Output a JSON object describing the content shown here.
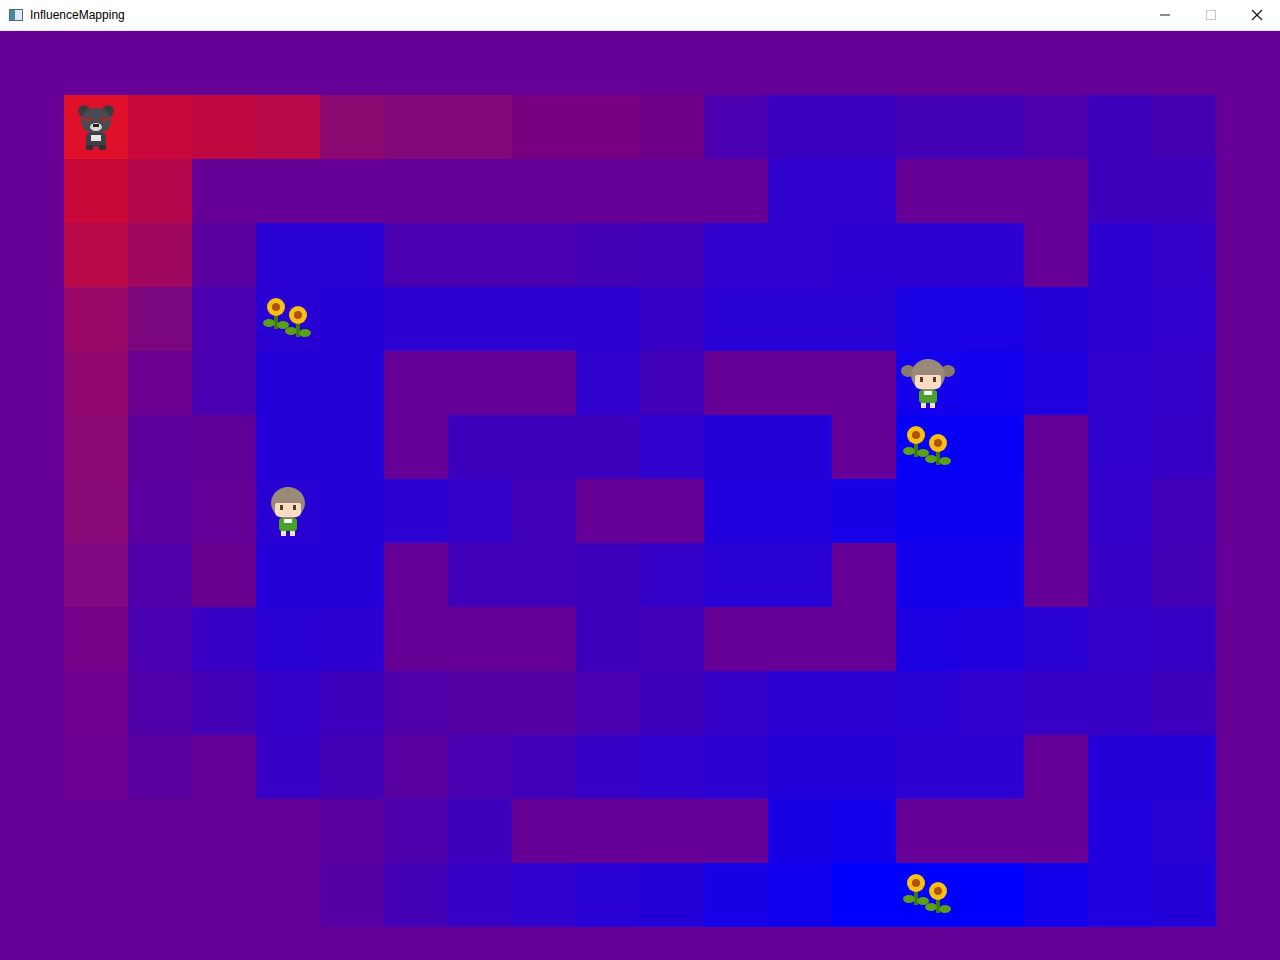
{
  "window": {
    "title": "InfluenceMapping",
    "controls": [
      {
        "kind": "minimize",
        "disabled": false
      },
      {
        "kind": "maximize",
        "disabled": true
      },
      {
        "kind": "close",
        "disabled": false
      }
    ]
  },
  "map": {
    "rows": [
      [
        "#660096",
        "#660096",
        "#660096",
        "#660096",
        "#660096",
        "#660096",
        "#660096",
        "#660096",
        "#660096",
        "#660096",
        "#660096",
        "#660096",
        "#660096",
        "#660096",
        "#660096",
        "#660096",
        "#660096",
        "#660096",
        "#660096",
        "#660096"
      ],
      [
        "#660096",
        "#e0102a",
        "#c8083a",
        "#c00840",
        "#b80848",
        "#8a0870",
        "#800878",
        "#800878",
        "#780080",
        "#780080",
        "#6e0088",
        "#4a00b0",
        "#3a00c0",
        "#3a00c0",
        "#4400b4",
        "#4400b4",
        "#4c00ac",
        "#3c00bc",
        "#4400b0",
        "#660096"
      ],
      [
        "#660096",
        "#c80838",
        "#b4084c",
        "#660096",
        "#660096",
        "#660096",
        "#660096",
        "#660096",
        "#660096",
        "#660096",
        "#660096",
        "#660096",
        "#3000cc",
        "#3000cc",
        "#660096",
        "#660096",
        "#660096",
        "#3c00bc",
        "#3c00bc",
        "#660096"
      ],
      [
        "#660096",
        "#b80848",
        "#a00860",
        "#5a00a0",
        "#2800d4",
        "#2800d4",
        "#4800b0",
        "#4800b0",
        "#4800b0",
        "#4400b4",
        "#4000b8",
        "#3000cc",
        "#3000cc",
        "#2c00d0",
        "#2c00d0",
        "#2c00d0",
        "#660096",
        "#2c00d0",
        "#3400c8",
        "#660096"
      ],
      [
        "#660096",
        "#9a0868",
        "#7c0880",
        "#4a00b0",
        "#2800d4",
        "#2400d8",
        "#2c00d0",
        "#2c00d0",
        "#2c00d0",
        "#2c00d0",
        "#3800c4",
        "#2800d4",
        "#2800d4",
        "#2800d4",
        "#1a00e4",
        "#1a00e4",
        "#2400d8",
        "#2c00d0",
        "#3000cc",
        "#660096"
      ],
      [
        "#660096",
        "#900870",
        "#6c0090",
        "#4800b0",
        "#2400d8",
        "#2400d8",
        "#660096",
        "#660096",
        "#660096",
        "#3000cc",
        "#4000b8",
        "#660096",
        "#660096",
        "#660096",
        "#1400ea",
        "#1000ee",
        "#2000dc",
        "#3000cc",
        "#3400c8",
        "#660096"
      ],
      [
        "#660096",
        "#8c0874",
        "#5e009c",
        "#600098",
        "#2400d8",
        "#2400d8",
        "#660096",
        "#3c00bc",
        "#3c00bc",
        "#3c00bc",
        "#3000cc",
        "#2400d8",
        "#2400d8",
        "#660096",
        "#0800f6",
        "#0800f6",
        "#660096",
        "#3000cc",
        "#3800c4",
        "#660096"
      ],
      [
        "#660096",
        "#880878",
        "#5a00a0",
        "#640098",
        "#2800d4",
        "#2400d8",
        "#2c00d0",
        "#3400c8",
        "#4000b8",
        "#660096",
        "#660096",
        "#2000dc",
        "#2000dc",
        "#1800e6",
        "#0c00f2",
        "#0c00f2",
        "#660096",
        "#3400c8",
        "#4000b8",
        "#660096"
      ],
      [
        "#660096",
        "#800880",
        "#5000a8",
        "#6a0090",
        "#2400d8",
        "#2400d8",
        "#660096",
        "#4000b8",
        "#4000b8",
        "#3c00bc",
        "#3400c8",
        "#2800d4",
        "#2800d4",
        "#660096",
        "#1400ea",
        "#1400ea",
        "#660096",
        "#3800c4",
        "#4400b4",
        "#660096"
      ],
      [
        "#660096",
        "#760088",
        "#4800b0",
        "#3800c4",
        "#2800d4",
        "#2c00d0",
        "#660096",
        "#660096",
        "#660096",
        "#3c00bc",
        "#4000b8",
        "#660096",
        "#660096",
        "#660096",
        "#1c00e2",
        "#2000dc",
        "#2800d4",
        "#3400c8",
        "#3800c4",
        "#660096"
      ],
      [
        "#660096",
        "#700090",
        "#5000a8",
        "#4400b4",
        "#3400c8",
        "#3c00bc",
        "#5000a8",
        "#5400a4",
        "#5400a4",
        "#4800b0",
        "#3c00bc",
        "#3400c8",
        "#2c00d0",
        "#2c00d0",
        "#2800d4",
        "#3000cc",
        "#3800c4",
        "#3800c4",
        "#3c00bc",
        "#660096"
      ],
      [
        "#660096",
        "#6c0094",
        "#5800a0",
        "#660096",
        "#3800c4",
        "#4400b4",
        "#5800a0",
        "#4800b0",
        "#4000b8",
        "#3800c4",
        "#3000cc",
        "#2c00d0",
        "#2400d8",
        "#2400d8",
        "#2c00d0",
        "#2c00d0",
        "#660096",
        "#2400d8",
        "#2400d8",
        "#660096"
      ],
      [
        "#660096",
        "#660096",
        "#660096",
        "#660096",
        "#660096",
        "#5800a0",
        "#4c00ac",
        "#3c00bc",
        "#660096",
        "#660096",
        "#660096",
        "#660096",
        "#1800e6",
        "#1400ea",
        "#660096",
        "#660096",
        "#660096",
        "#2000dc",
        "#2800d4",
        "#660096"
      ],
      [
        "#660096",
        "#660096",
        "#660096",
        "#660096",
        "#660096",
        "#5400a4",
        "#4400b4",
        "#3800c4",
        "#3000cc",
        "#2800d4",
        "#2400d8",
        "#1800e6",
        "#1000ee",
        "#0000ff",
        "#0000ff",
        "#0000ff",
        "#1400ea",
        "#2000dc",
        "#2400d8",
        "#660096"
      ],
      [
        "#660096",
        "#660096",
        "#660096",
        "#660096",
        "#660096",
        "#660096",
        "#660096",
        "#660096",
        "#660096",
        "#660096",
        "#660096",
        "#660096",
        "#660096",
        "#660096",
        "#660096",
        "#660096",
        "#660096",
        "#660096",
        "#660096",
        "#660096"
      ]
    ]
  },
  "entities": [
    {
      "kind": "bear",
      "row": 1,
      "col": 1
    },
    {
      "kind": "sunflower",
      "row": 4,
      "col": 4
    },
    {
      "kind": "girl-pigtails",
      "row": 5,
      "col": 14
    },
    {
      "kind": "sunflower",
      "row": 6,
      "col": 14
    },
    {
      "kind": "girl",
      "row": 7,
      "col": 4
    },
    {
      "kind": "sunflower",
      "row": 13,
      "col": 14
    }
  ]
}
